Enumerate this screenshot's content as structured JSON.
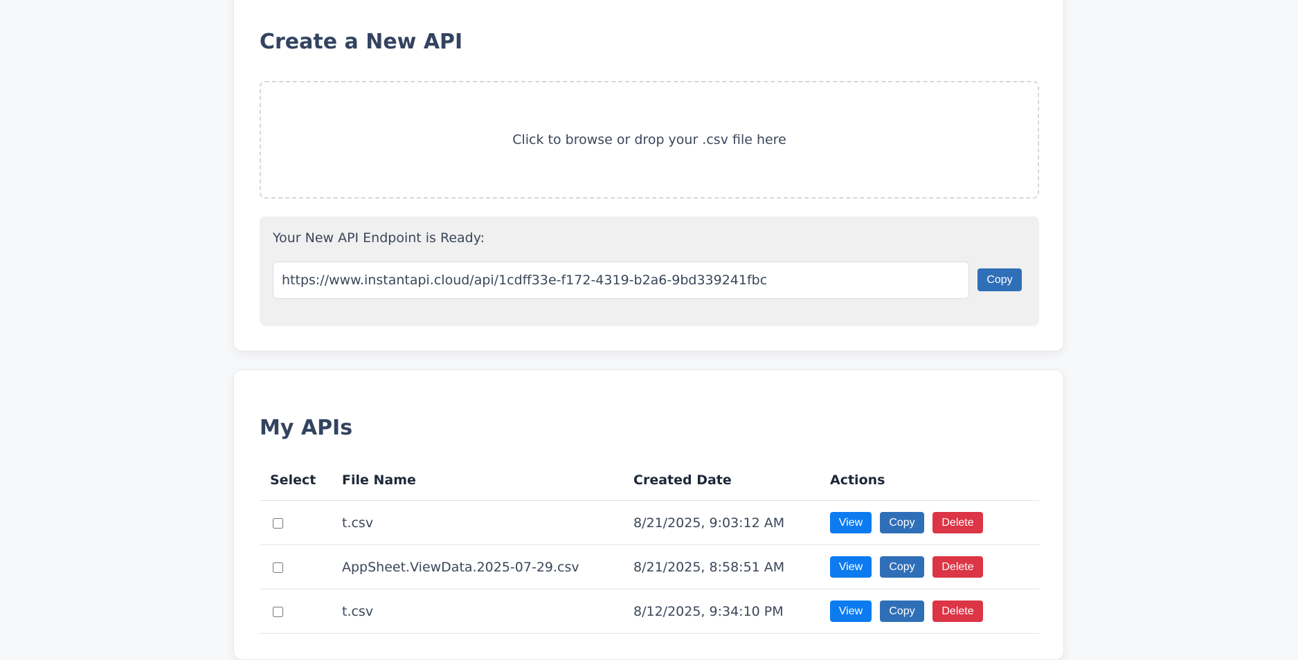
{
  "create_section": {
    "title": "Create a New API",
    "dropzone_text": "Click to browse or drop your .csv file here",
    "endpoint_label": "Your New API Endpoint is Ready:",
    "endpoint_url": "https://www.instantapi.cloud/api/1cdff33e-f172-4319-b2a6-9bd339241fbc",
    "copy_label": "Copy"
  },
  "list_section": {
    "title": "My APIs",
    "columns": [
      "Select",
      "File Name",
      "Created Date",
      "Actions"
    ],
    "rows": [
      {
        "file_name": "t.csv",
        "created": "8/21/2025, 9:03:12 AM"
      },
      {
        "file_name": "AppSheet.ViewData.2025-07-29.csv",
        "created": "8/21/2025, 8:58:51 AM"
      },
      {
        "file_name": "t.csv",
        "created": "8/12/2025, 9:34:10 PM"
      }
    ],
    "actions": {
      "view_label": "View",
      "copy_label": "Copy",
      "delete_label": "Delete"
    }
  },
  "colors": {
    "view": "#0d7bf0",
    "copy": "#2f6fb8",
    "delete": "#dc3545",
    "heading": "#334360"
  }
}
